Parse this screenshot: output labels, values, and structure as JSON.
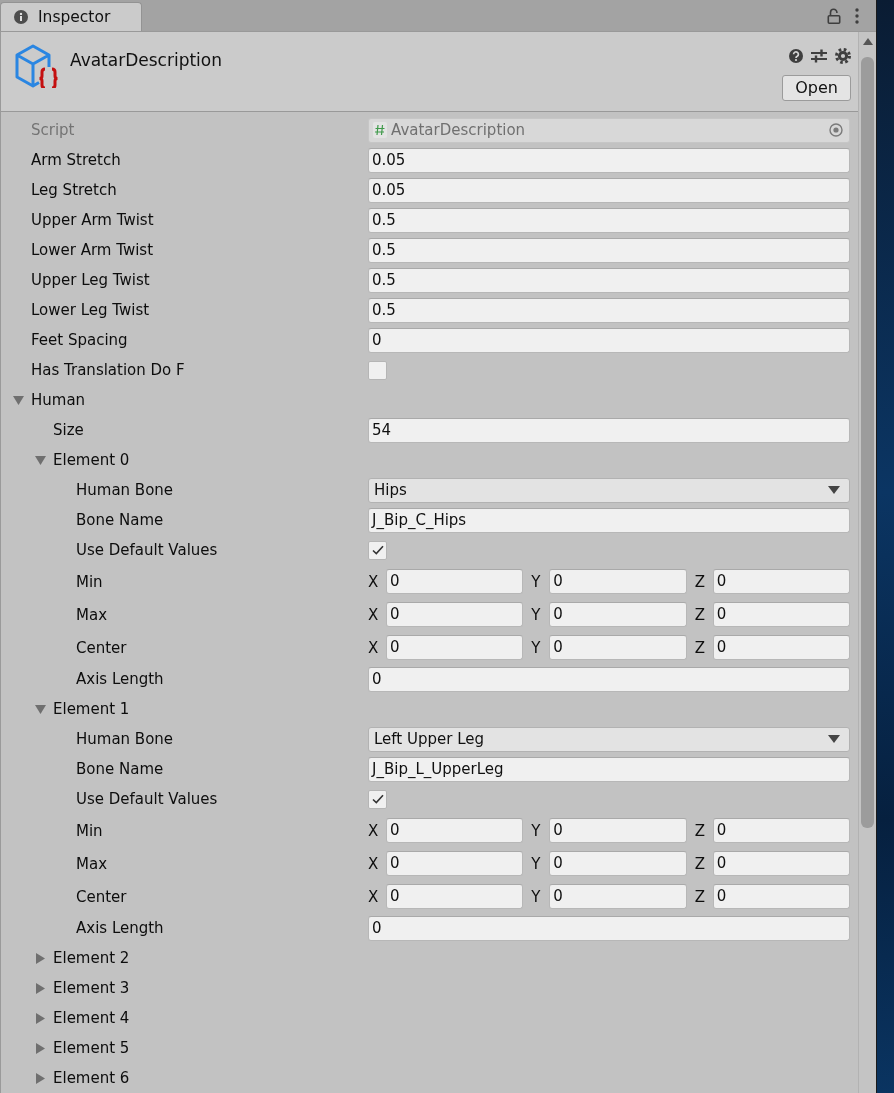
{
  "tab": {
    "label": "Inspector",
    "selected": true
  },
  "header": {
    "title": "AvatarDescription",
    "button": "Open"
  },
  "properties": [
    {
      "kind": "object",
      "label": "Script",
      "value": "AvatarDescription",
      "disabled": true
    },
    {
      "kind": "number",
      "label": "Arm Stretch",
      "value": "0.05"
    },
    {
      "kind": "number",
      "label": "Leg Stretch",
      "value": "0.05"
    },
    {
      "kind": "number",
      "label": "Upper Arm Twist",
      "value": "0.5"
    },
    {
      "kind": "number",
      "label": "Lower Arm Twist",
      "value": "0.5"
    },
    {
      "kind": "number",
      "label": "Upper Leg Twist",
      "value": "0.5"
    },
    {
      "kind": "number",
      "label": "Lower Leg Twist",
      "value": "0.5"
    },
    {
      "kind": "number",
      "label": "Feet Spacing",
      "value": "0"
    },
    {
      "kind": "checkbox",
      "label": "Has Translation Do F",
      "checked": false
    },
    {
      "kind": "foldout",
      "label": "Human",
      "expanded": true,
      "children": [
        {
          "kind": "number",
          "label": "Size",
          "value": "54"
        },
        {
          "kind": "foldout",
          "label": "Element 0",
          "expanded": true,
          "children": [
            {
              "kind": "dropdown",
              "label": "Human Bone",
              "value": "Hips"
            },
            {
              "kind": "text",
              "label": "Bone Name",
              "value": "J_Bip_C_Hips"
            },
            {
              "kind": "checkbox",
              "label": "Use Default Values",
              "checked": true
            },
            {
              "kind": "vector",
              "label": "Min",
              "components": [
                {
                  "axis": "X",
                  "value": "0"
                },
                {
                  "axis": "Y",
                  "value": "0"
                },
                {
                  "axis": "Z",
                  "value": "0"
                }
              ]
            },
            {
              "kind": "vector",
              "label": "Max",
              "components": [
                {
                  "axis": "X",
                  "value": "0"
                },
                {
                  "axis": "Y",
                  "value": "0"
                },
                {
                  "axis": "Z",
                  "value": "0"
                }
              ]
            },
            {
              "kind": "vector",
              "label": "Center",
              "components": [
                {
                  "axis": "X",
                  "value": "0"
                },
                {
                  "axis": "Y",
                  "value": "0"
                },
                {
                  "axis": "Z",
                  "value": "0"
                }
              ]
            },
            {
              "kind": "number",
              "label": "Axis Length",
              "value": "0"
            }
          ]
        },
        {
          "kind": "foldout",
          "label": "Element 1",
          "expanded": true,
          "children": [
            {
              "kind": "dropdown",
              "label": "Human Bone",
              "value": "Left Upper Leg"
            },
            {
              "kind": "text",
              "label": "Bone Name",
              "value": "J_Bip_L_UpperLeg"
            },
            {
              "kind": "checkbox",
              "label": "Use Default Values",
              "checked": true
            },
            {
              "kind": "vector",
              "label": "Min",
              "components": [
                {
                  "axis": "X",
                  "value": "0"
                },
                {
                  "axis": "Y",
                  "value": "0"
                },
                {
                  "axis": "Z",
                  "value": "0"
                }
              ]
            },
            {
              "kind": "vector",
              "label": "Max",
              "components": [
                {
                  "axis": "X",
                  "value": "0"
                },
                {
                  "axis": "Y",
                  "value": "0"
                },
                {
                  "axis": "Z",
                  "value": "0"
                }
              ]
            },
            {
              "kind": "vector",
              "label": "Center",
              "components": [
                {
                  "axis": "X",
                  "value": "0"
                },
                {
                  "axis": "Y",
                  "value": "0"
                },
                {
                  "axis": "Z",
                  "value": "0"
                }
              ]
            },
            {
              "kind": "number",
              "label": "Axis Length",
              "value": "0"
            }
          ]
        },
        {
          "kind": "foldout",
          "label": "Element 2",
          "expanded": false
        },
        {
          "kind": "foldout",
          "label": "Element 3",
          "expanded": false
        },
        {
          "kind": "foldout",
          "label": "Element 4",
          "expanded": false
        },
        {
          "kind": "foldout",
          "label": "Element 5",
          "expanded": false
        },
        {
          "kind": "foldout",
          "label": "Element 6",
          "expanded": false
        }
      ]
    }
  ]
}
